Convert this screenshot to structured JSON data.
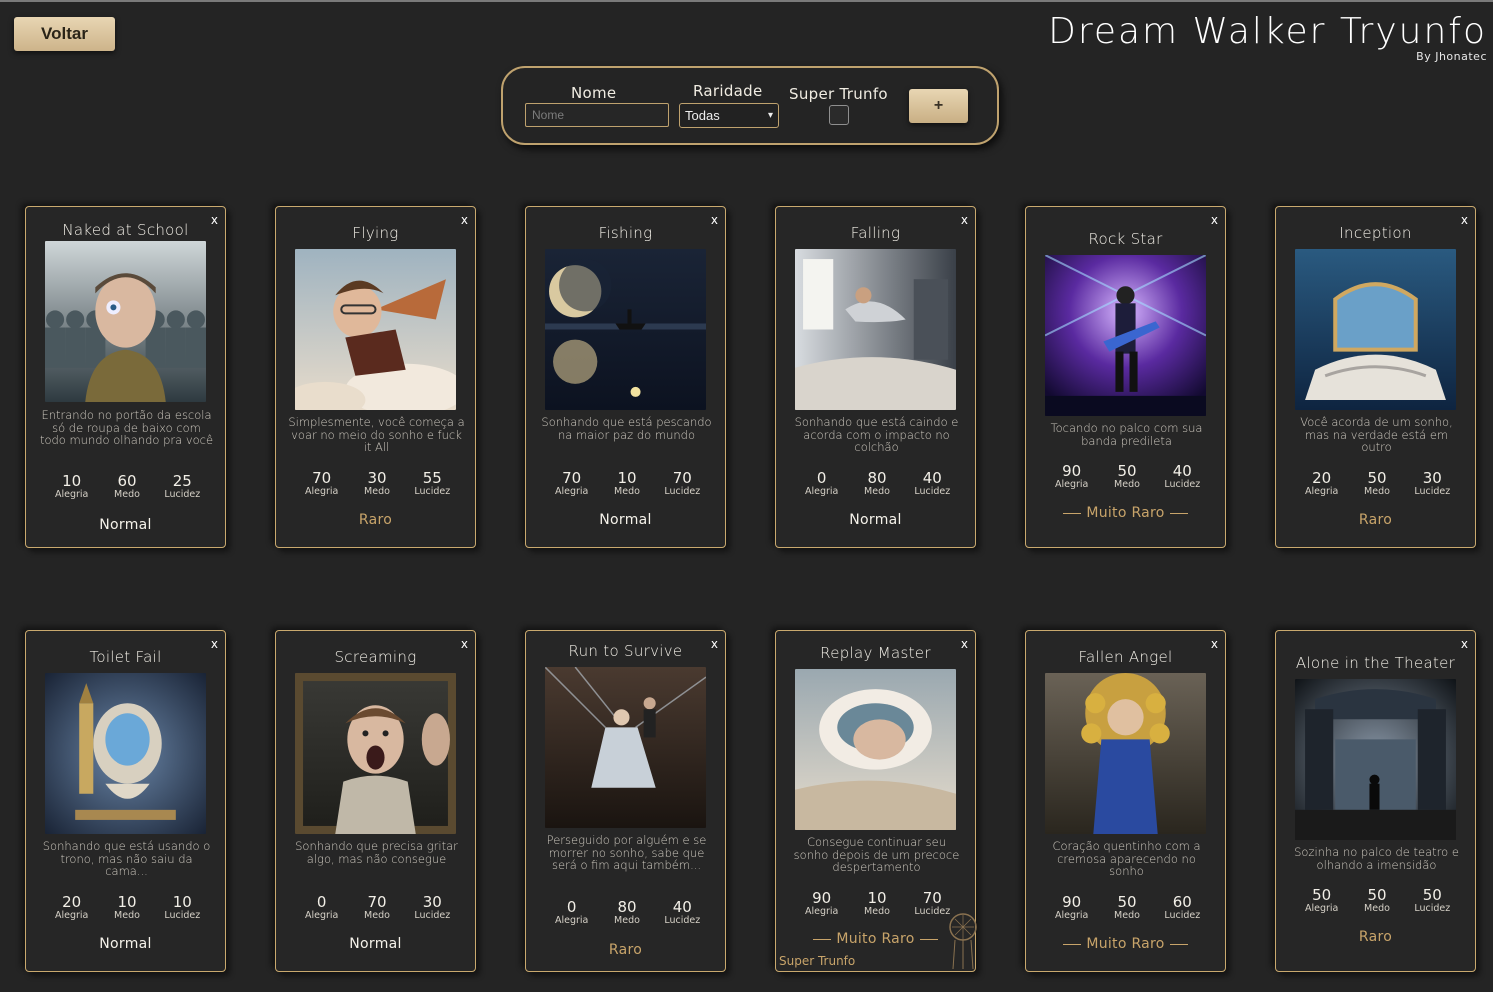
{
  "header": {
    "back_label": "Voltar",
    "brand_title": "Dream Walker Tryunfo",
    "brand_subtitle": "By Jhonatec"
  },
  "filters": {
    "name_label": "Nome",
    "name_placeholder": "Nome",
    "rarity_label": "Raridade",
    "rarity_selected": "Todas",
    "super_label": "Super Trunfo",
    "add_label": "+"
  },
  "attr_labels": [
    "Alegria",
    "Medo",
    "Lucidez"
  ],
  "delete_label": "x",
  "super_tag": "Super Trunfo",
  "cards": [
    {
      "name": "Naked at School",
      "desc": "Entrando no portão da escola só de roupa de baixo com todo mundo olhando pra você",
      "attrs": [
        "10",
        "60",
        "25"
      ],
      "rarity": "Normal",
      "scene": "school"
    },
    {
      "name": "Flying",
      "desc": "Simplesmente, você começa a voar no meio do sonho e fuck it All",
      "attrs": [
        "70",
        "30",
        "55"
      ],
      "rarity": "Raro",
      "scene": "flying"
    },
    {
      "name": "Fishing",
      "desc": "Sonhando que está pescando na maior paz do mundo",
      "attrs": [
        "70",
        "10",
        "70"
      ],
      "rarity": "Normal",
      "scene": "fishing"
    },
    {
      "name": "Falling",
      "desc": "Sonhando que está caindo e acorda com o impacto no colchão",
      "attrs": [
        "0",
        "80",
        "40"
      ],
      "rarity": "Normal",
      "scene": "falling"
    },
    {
      "name": "Rock Star",
      "desc": "Tocando no palco com sua banda predileta",
      "attrs": [
        "90",
        "50",
        "40"
      ],
      "rarity": "Muito Raro",
      "scene": "rock"
    },
    {
      "name": "Inception",
      "desc": "Você acorda de um sonho, mas na verdade está em outro",
      "attrs": [
        "20",
        "50",
        "30"
      ],
      "rarity": "Raro",
      "scene": "inception"
    },
    {
      "name": "Toilet Fail",
      "desc": "Sonhando que está usando o trono, mas não saiu da cama...",
      "attrs": [
        "20",
        "10",
        "10"
      ],
      "rarity": "Normal",
      "scene": "toilet"
    },
    {
      "name": "Screaming",
      "desc": "Sonhando que precisa gritar algo, mas não consegue",
      "attrs": [
        "0",
        "70",
        "30"
      ],
      "rarity": "Normal",
      "scene": "scream"
    },
    {
      "name": "Run to Survive",
      "desc": "Perseguido por alguém e se morrer no sonho, sabe que será o fim aqui também...",
      "attrs": [
        "0",
        "80",
        "40"
      ],
      "rarity": "Raro",
      "scene": "run"
    },
    {
      "name": "Replay Master",
      "desc": "Consegue continuar seu sonho depois de um precoce despertamento",
      "attrs": [
        "90",
        "10",
        "70"
      ],
      "rarity": "Muito Raro",
      "scene": "replay",
      "super": true
    },
    {
      "name": "Fallen Angel",
      "desc": "Coração quentinho com a cremosa aparecendo no sonho",
      "attrs": [
        "90",
        "50",
        "60"
      ],
      "rarity": "Muito Raro",
      "scene": "angel"
    },
    {
      "name": "Alone in the Theater",
      "desc": "Sozinha no palco de teatro e olhando a imensidão",
      "attrs": [
        "50",
        "50",
        "50"
      ],
      "rarity": "Raro",
      "scene": "theater"
    }
  ],
  "colors": {
    "accent": "#c9a96e",
    "background": "#242424",
    "button": "#d9c29a"
  }
}
